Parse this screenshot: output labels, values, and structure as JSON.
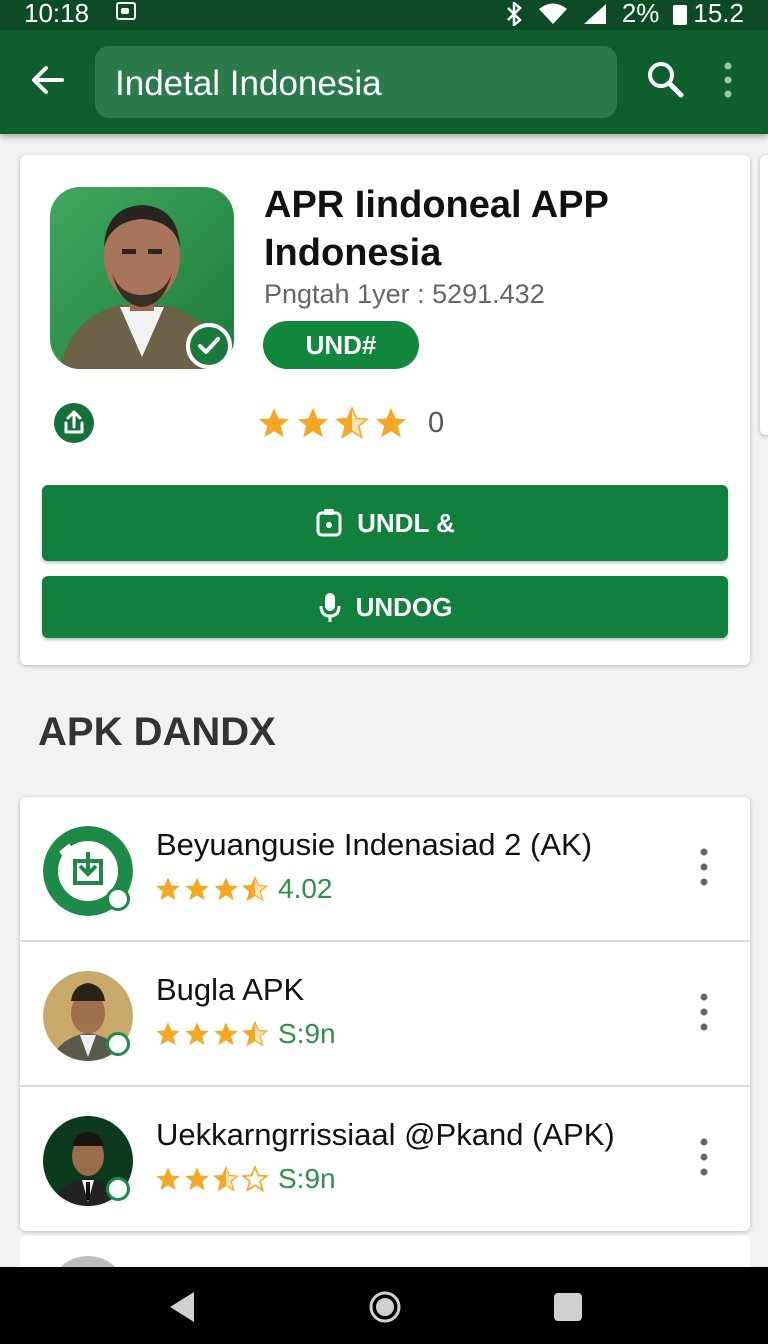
{
  "status_bar": {
    "time": "10:18",
    "right_text": "2%",
    "clock_right": "15.2",
    "icons": [
      "image-icon",
      "bluetooth-icon",
      "wifi-icon",
      "signal-icon",
      "battery-icon"
    ]
  },
  "app_bar": {
    "search_text": "Indetal Indonesia",
    "icons": [
      "back-arrow-icon",
      "search-icon",
      "more-vert-icon"
    ]
  },
  "app_card": {
    "title": "APR Iindoneal APP Indonesia",
    "meta": "Pngtah 1yer : 5291.432",
    "pill_label": "UND#",
    "rating_count": "0",
    "stars": 3.5,
    "primary_button": "UNDL &",
    "secondary_button": "UNDOG",
    "colors": {
      "green": "#12803d",
      "dark_green": "#0f5e2f"
    }
  },
  "section": {
    "title": "APK DANDX"
  },
  "list": [
    {
      "title": "Beyuangusie Indenasiad 2 (AK)",
      "rating_text": "4.02",
      "stars": 3.5,
      "avatar": "download-logo"
    },
    {
      "title": "Bugla APK",
      "rating_text": "S:9n",
      "stars": 3.5,
      "avatar": "person-photo"
    },
    {
      "title": "Uekkarngrrissiaal @Pkand (APK)",
      "rating_text": "S:9n",
      "stars": 2.5,
      "avatar": "person-photo-dark"
    }
  ],
  "nav_bar": {
    "icons": [
      "back-triangle-icon",
      "home-circle-icon",
      "recents-square-icon"
    ]
  }
}
